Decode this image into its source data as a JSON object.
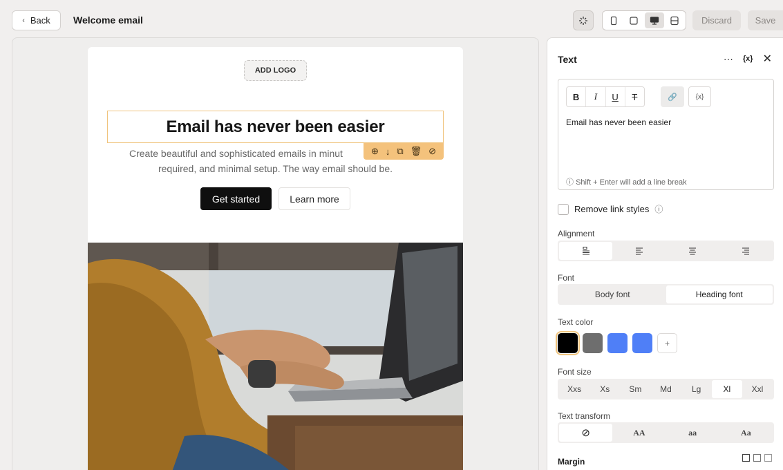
{
  "header": {
    "back_label": "Back",
    "page_title": "Welcome email",
    "discard_label": "Discard",
    "save_label": "Save",
    "view_modes": [
      "mobile-view-icon",
      "tablet-view-icon",
      "desktop-view-icon",
      "split-view-icon"
    ],
    "active_view": "desktop-view-icon"
  },
  "email": {
    "add_logo_label": "ADD LOGO",
    "heading": "Email has never been easier",
    "subtext_line1": "Create beautiful and sophisticated emails in minut",
    "subtext_line2": "required, and minimal setup. The way email should be.",
    "primary_button": "Get started",
    "secondary_button": "Learn more"
  },
  "panel": {
    "title": "Text",
    "editor": {
      "bold": "B",
      "italic": "I",
      "underline": "U",
      "strike": "T",
      "variable": "{x}",
      "content": "Email has never been easier",
      "hint": "Shift + Enter will add a line break"
    },
    "remove_link_label": "Remove link styles",
    "alignment": {
      "label": "Alignment",
      "options": [
        "align-auto-icon",
        "align-left-icon",
        "align-center-icon",
        "align-right-icon"
      ],
      "active_index": 0
    },
    "font": {
      "label": "Font",
      "options": [
        "Body font",
        "Heading font"
      ],
      "active_index": 1
    },
    "text_color": {
      "label": "Text color",
      "swatches": [
        "#000000",
        "#6e6e6e",
        "#4f7ff7",
        "#4f7ff7"
      ],
      "selected_index": 0,
      "add_label": "+"
    },
    "font_size": {
      "label": "Font size",
      "options": [
        "Xxs",
        "Xs",
        "Sm",
        "Md",
        "Lg",
        "Xl",
        "Xxl"
      ],
      "active_index": 5
    },
    "text_transform": {
      "label": "Text transform",
      "options": [
        "⊘",
        "AA",
        "aa",
        "Aa"
      ],
      "active_index": 0
    },
    "margin_label": "Margin"
  }
}
